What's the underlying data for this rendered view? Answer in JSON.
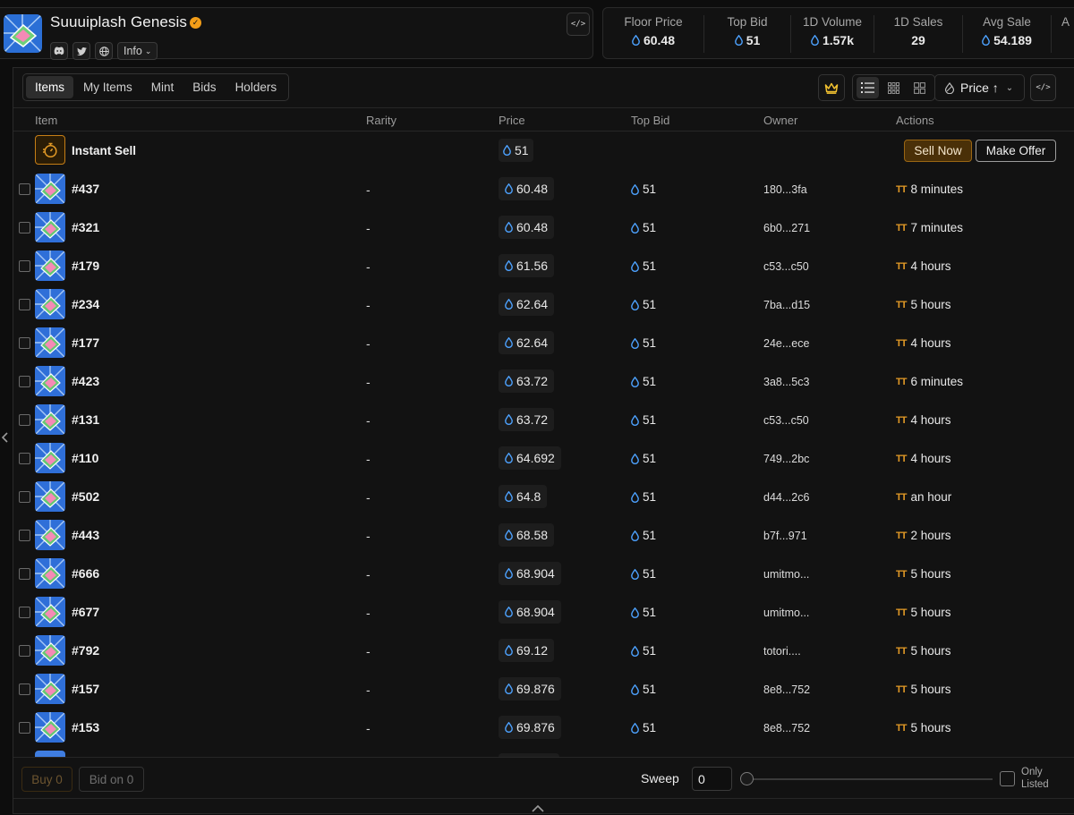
{
  "collection": {
    "name": "Suuuiplash Genesis",
    "info_label": "Info"
  },
  "stats": [
    {
      "label": "Floor Price",
      "value": "60.48",
      "sui": true
    },
    {
      "label": "Top Bid",
      "value": "51",
      "sui": true
    },
    {
      "label": "1D Volume",
      "value": "1.57k",
      "sui": true
    },
    {
      "label": "1D Sales",
      "value": "29",
      "sui": false
    },
    {
      "label": "Avg Sale",
      "value": "54.189",
      "sui": true
    },
    {
      "label": "A",
      "value": "",
      "sui": false
    }
  ],
  "tabs": [
    "Items",
    "My Items",
    "Mint",
    "Bids",
    "Holders"
  ],
  "sort_label": "Price ↑",
  "columns": {
    "item": "Item",
    "rarity": "Rarity",
    "price": "Price",
    "top_bid": "Top Bid",
    "owner": "Owner",
    "actions": "Actions"
  },
  "instant_sell": {
    "label": "Instant Sell",
    "price": "51",
    "sell_now": "Sell Now",
    "make_offer": "Make Offer"
  },
  "rows": [
    {
      "id": "#437",
      "rarity": "-",
      "price": "60.48",
      "top_bid": "51",
      "owner": "180...3fa",
      "listed": "8 minutes"
    },
    {
      "id": "#321",
      "rarity": "-",
      "price": "60.48",
      "top_bid": "51",
      "owner": "6b0...271",
      "listed": "7 minutes"
    },
    {
      "id": "#179",
      "rarity": "-",
      "price": "61.56",
      "top_bid": "51",
      "owner": "c53...c50",
      "listed": "4 hours"
    },
    {
      "id": "#234",
      "rarity": "-",
      "price": "62.64",
      "top_bid": "51",
      "owner": "7ba...d15",
      "listed": "5 hours"
    },
    {
      "id": "#177",
      "rarity": "-",
      "price": "62.64",
      "top_bid": "51",
      "owner": "24e...ece",
      "listed": "4 hours"
    },
    {
      "id": "#423",
      "rarity": "-",
      "price": "63.72",
      "top_bid": "51",
      "owner": "3a8...5c3",
      "listed": "6 minutes"
    },
    {
      "id": "#131",
      "rarity": "-",
      "price": "63.72",
      "top_bid": "51",
      "owner": "c53...c50",
      "listed": "4 hours"
    },
    {
      "id": "#110",
      "rarity": "-",
      "price": "64.692",
      "top_bid": "51",
      "owner": "749...2bc",
      "listed": "4 hours"
    },
    {
      "id": "#502",
      "rarity": "-",
      "price": "64.8",
      "top_bid": "51",
      "owner": "d44...2c6",
      "listed": "an hour"
    },
    {
      "id": "#443",
      "rarity": "-",
      "price": "68.58",
      "top_bid": "51",
      "owner": "b7f...971",
      "listed": "2 hours"
    },
    {
      "id": "#666",
      "rarity": "-",
      "price": "68.904",
      "top_bid": "51",
      "owner": "umitmo...",
      "listed": "5 hours"
    },
    {
      "id": "#677",
      "rarity": "-",
      "price": "68.904",
      "top_bid": "51",
      "owner": "umitmo...",
      "listed": "5 hours"
    },
    {
      "id": "#792",
      "rarity": "-",
      "price": "69.12",
      "top_bid": "51",
      "owner": "totori....",
      "listed": "5 hours"
    },
    {
      "id": "#157",
      "rarity": "-",
      "price": "69.876",
      "top_bid": "51",
      "owner": "8e8...752",
      "listed": "5 hours"
    },
    {
      "id": "#153",
      "rarity": "-",
      "price": "69.876",
      "top_bid": "51",
      "owner": "8e8...752",
      "listed": "5 hours"
    }
  ],
  "footer": {
    "buy_label": "Buy 0",
    "bid_label": "Bid on 0",
    "sweep_label": "Sweep",
    "sweep_value": "0",
    "only_listed_1": "Only",
    "only_listed_2": "Listed"
  },
  "colors": {
    "accent": "#f29d18",
    "sui": "#4da2ff",
    "background": "#0d0d0d"
  }
}
